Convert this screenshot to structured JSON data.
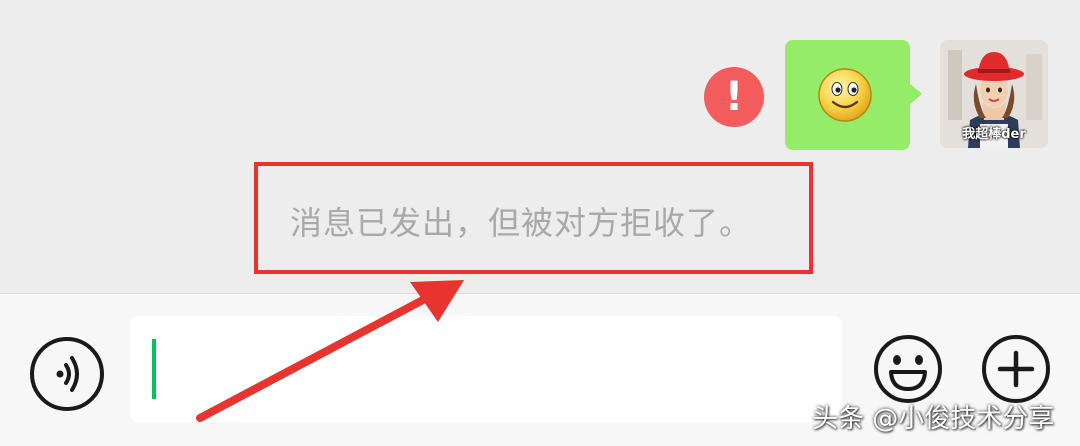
{
  "conversation": {
    "status_icon": "exclamation-error-icon",
    "status_glyph": "!",
    "sent_message": {
      "type": "emoji",
      "icon": "smiley-face-icon"
    },
    "avatar": {
      "caption": "我超棒der"
    },
    "system_notice": "消息已发出，但被对方拒收了。"
  },
  "input_bar": {
    "voice_icon": "voice-icon",
    "text_value": "",
    "emoji_icon": "emoji-face-icon",
    "plus_icon": "plus-icon"
  },
  "annotation": {
    "highlight_color": "#e8342f",
    "arrow_color": "#e8342f"
  },
  "watermark": "头条 @小俊技术分享",
  "colors": {
    "bubble": "#95ec69",
    "error": "#f25c5c",
    "caret": "#07c160"
  }
}
